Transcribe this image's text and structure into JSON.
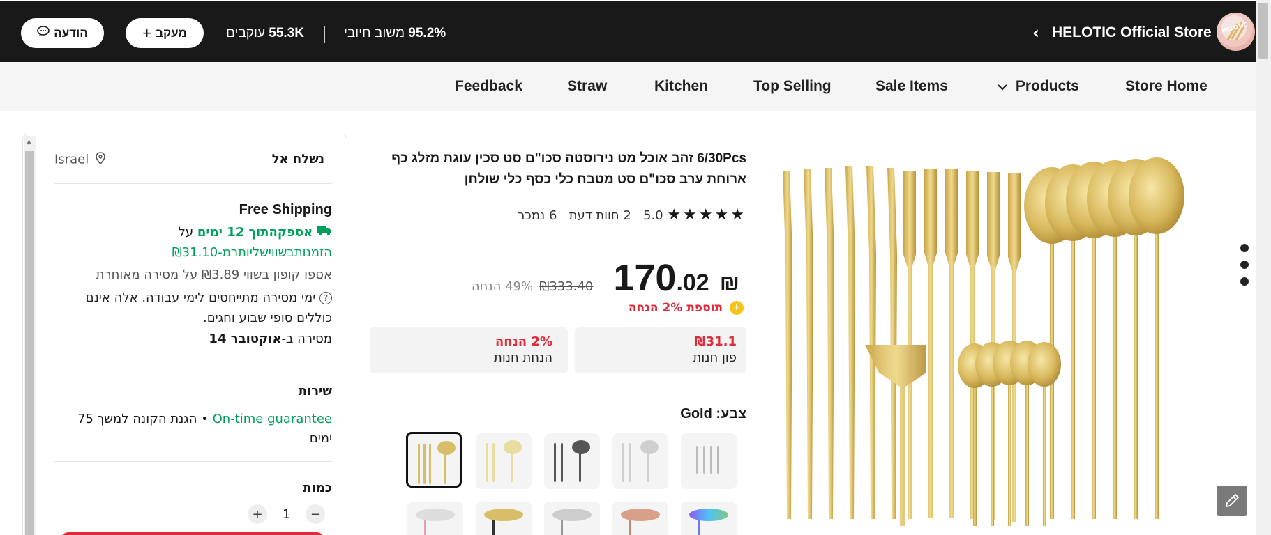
{
  "store": {
    "name": "HELOTIC Official Store",
    "logo_text": "HELOTIC",
    "rating_value": "95.2%",
    "rating_label": "משוב חיובי",
    "followers_value": "55.3K",
    "followers_label": "עוקבים",
    "follow_label": "מעקב",
    "message_label": "הודעה"
  },
  "nav": {
    "items": [
      "Store Home",
      "Products",
      "Sale Items",
      "Top Selling",
      "Kitchen",
      "Straw",
      "Feedback"
    ]
  },
  "product": {
    "title": "6/30Pcs זהב אוכל מט נירוסטה סכו\"ם סט סכין עוגת מזלג כף ארוחת ערב סכו\"ם סט מטבח כלי כסף כלי שולחן",
    "stars": "★★★★★",
    "rating": "5.0",
    "reviews": "2 חוות דעת",
    "sold": "6 נמכר",
    "currency": "₪",
    "price_int": "170",
    "price_dec": ".02",
    "old_price": "₪333.40",
    "discount": "49% הנחה",
    "extra_discount": "תוספת 2% הנחה",
    "coupons": [
      {
        "value": "₪31.1",
        "label": "פון חנות"
      },
      {
        "value": "2% הנחה",
        "label": "הנחת חנות"
      }
    ],
    "color_label": "צבע: Gold"
  },
  "shipping": {
    "ship_to_label": "נשלח אל",
    "location": "Israel",
    "free_shipping": "Free Shipping",
    "delivery_prefix": "על",
    "delivery_highlight": "אספקהתוך 12 ימים",
    "min_order": "הזמנותבשווישליותרמ-₪31.10",
    "late_coupon": "אספו קופון בשווי ₪3.89 על מסירה מאוחרת",
    "note": "ימי מסירה מתייחסים לימי עבודה. אלה אינם כוללים סופי שבוע וחגים.",
    "delivery_date_prefix": "מסירה ב-",
    "delivery_date": "אוקטובר 14"
  },
  "service": {
    "heading": "שירות",
    "guarantee": "On-time guarantee",
    "protection": " • הגנת הקונה למשך 75 ימים"
  },
  "quantity": {
    "heading": "כמות",
    "value": "1",
    "plus": "+",
    "minus": "−"
  },
  "colors": {
    "gold": "#d9be6a",
    "black_bar": "#191919",
    "green": "#00a05a",
    "red": "#e02b3a"
  }
}
